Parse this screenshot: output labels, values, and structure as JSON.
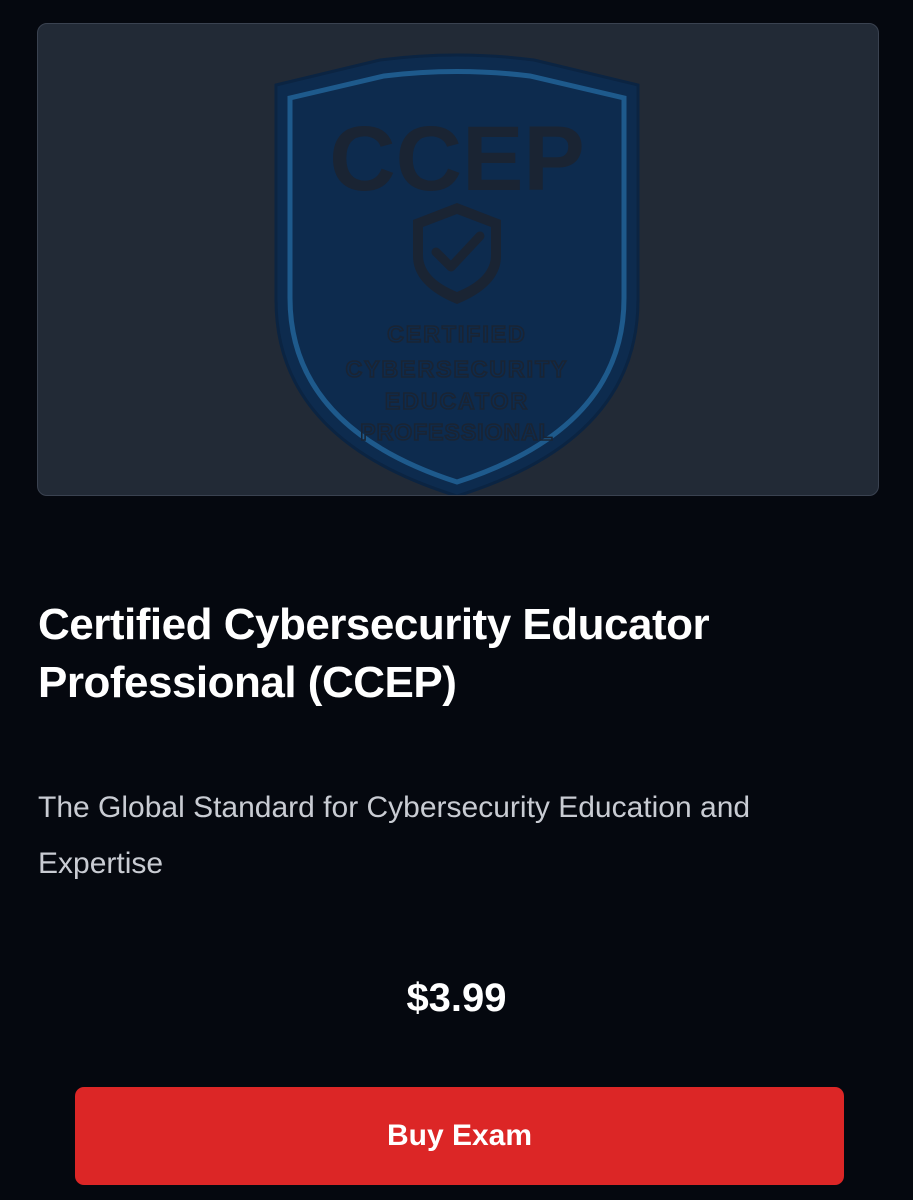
{
  "badge": {
    "acronym": "CCEP",
    "line1": "CERTIFIED",
    "line2": "CYBERSECURITY",
    "line3": "EDUCATOR",
    "line4": "PROFESSIONAL",
    "colors": {
      "shield_fill": "#0d2b4e",
      "shield_border": "#1e5a8c",
      "text": "#1a2433",
      "background": "#222a36"
    }
  },
  "product": {
    "title": "Certified Cybersecurity Educator Professional (CCEP)",
    "subtitle": "The Global Standard for Cybersecurity Education and Expertise",
    "price": "$3.99",
    "buy_label": "Buy Exam"
  },
  "colors": {
    "page_background": "#05080f",
    "button": "#dc2626",
    "subtitle_text": "#c9ccd3"
  }
}
